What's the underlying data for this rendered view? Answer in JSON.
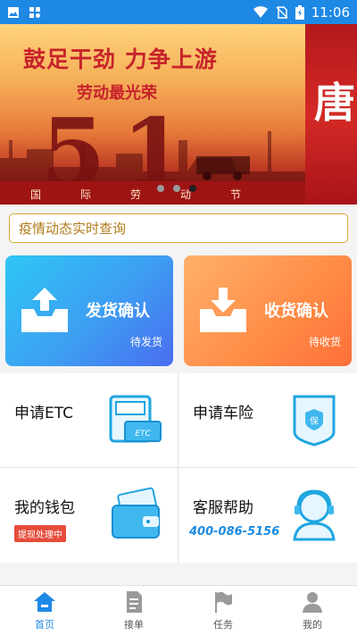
{
  "status_bar": {
    "time": "11:06",
    "icons": [
      "image-icon",
      "grid-app-icon",
      "wifi-icon",
      "no-sim-icon",
      "battery-charging-icon"
    ]
  },
  "banner": {
    "title": "鼓足干劲 力争上游",
    "subtitle": "劳动最光荣",
    "number": "51",
    "strip_chars": [
      "国",
      "际",
      "劳",
      "动",
      "节"
    ],
    "next_slide_char": "唐",
    "dots_count": 3,
    "active_dot": 2
  },
  "query": {
    "label": "疫情动态实时查询"
  },
  "cards": {
    "send": {
      "title": "发货确认",
      "sub": "待发货"
    },
    "receive": {
      "title": "收货确认",
      "sub": "待收货"
    }
  },
  "services": {
    "etc": {
      "label": "申请ETC",
      "icon": "etc-card-icon"
    },
    "insurance": {
      "label": "申请车险",
      "icon": "insurance-shield-icon"
    },
    "wallet": {
      "label": "我的钱包",
      "badge": "提现处理中",
      "icon": "wallet-icon"
    },
    "support": {
      "label": "客服帮助",
      "phone": "400-086-5156",
      "icon": "customer-service-icon"
    }
  },
  "tabbar": {
    "tabs": [
      {
        "label": "首页",
        "icon": "home-icon",
        "active": true
      },
      {
        "label": "接单",
        "icon": "document-icon",
        "active": false
      },
      {
        "label": "任务",
        "icon": "flag-icon",
        "active": false
      },
      {
        "label": "我的",
        "icon": "user-icon",
        "active": false
      }
    ]
  },
  "colors": {
    "primary": "#1e88e5",
    "send_card": "#3d9ef2",
    "receive_card": "#ff8b45",
    "query_border": "#d9a83b",
    "badge": "#e64b3b"
  }
}
